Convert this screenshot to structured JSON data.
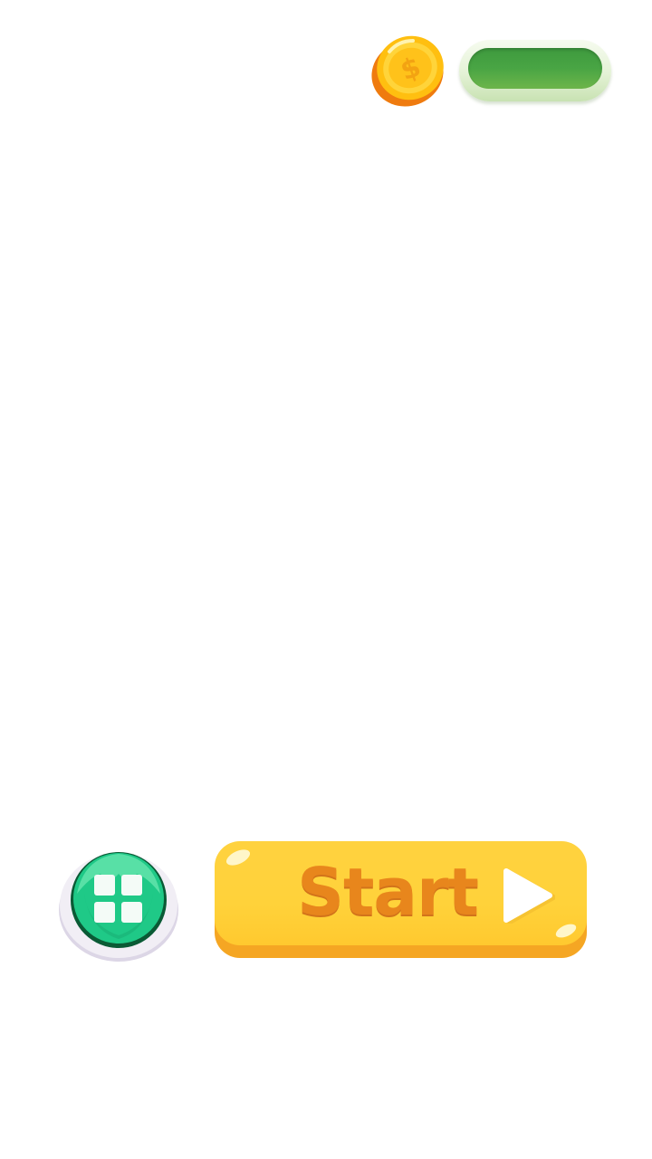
{
  "hud": {
    "coin_icon": "dollar-coin-icon",
    "coin_balance": ""
  },
  "buttons": {
    "menu_icon": "grid-icon",
    "start_label": "Start",
    "start_icon": "play-icon"
  },
  "colors": {
    "coin_gold": "#ffcf1a",
    "coin_orange": "#f08a10",
    "balance_green": "#49a544",
    "menu_green": "#1fd18b",
    "start_yellow": "#ffd23f",
    "start_text_orange": "#e8861c"
  }
}
